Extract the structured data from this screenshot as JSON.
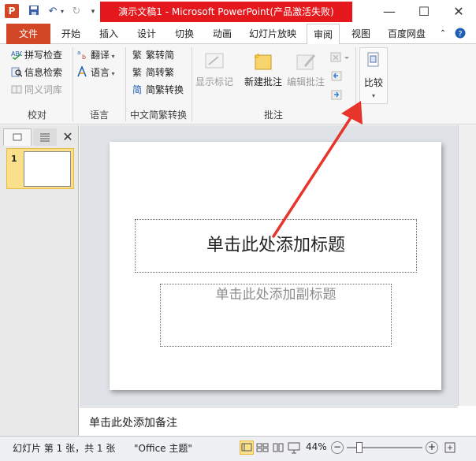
{
  "window": {
    "title": "演示文稿1 - Microsoft PowerPoint(产品激活失败)",
    "app_icon": "P",
    "minimize": "—",
    "maximize": "☐",
    "close": "✕"
  },
  "tabs": [
    "文件",
    "开始",
    "插入",
    "设计",
    "切换",
    "动画",
    "幻灯片放映",
    "审阅",
    "视图",
    "百度网盘"
  ],
  "active_tab": "审阅",
  "ribbon": {
    "proofing": {
      "items": [
        "拼写检查",
        "信息检索",
        "同义词库"
      ],
      "group": "校对"
    },
    "language": {
      "items": [
        "翻译",
        "语言"
      ],
      "group": "语言"
    },
    "chinese": {
      "items": [
        "繁转简",
        "简转繁",
        "简繁转换"
      ],
      "group": "中文简繁转换"
    },
    "comments": {
      "show_markup": "显示标记",
      "new_comment": "新建批注",
      "edit_comment": "编辑批注",
      "group": "批注"
    },
    "compare": {
      "label": "比较"
    }
  },
  "slides_pane": {
    "slide_number": "1"
  },
  "slide": {
    "title_placeholder": "单击此处添加标题",
    "subtitle_placeholder": "单击此处添加副标题"
  },
  "notes": {
    "placeholder": "单击此处添加备注"
  },
  "status": {
    "slide_info": "幻灯片 第 1 张，共 1 张",
    "theme": "\"Office 主题\"",
    "zoom": "44%"
  },
  "colors": {
    "title_bar_red": "#e5181d",
    "file_tab": "#d24726",
    "annotation_arrow": "#e8352b"
  }
}
